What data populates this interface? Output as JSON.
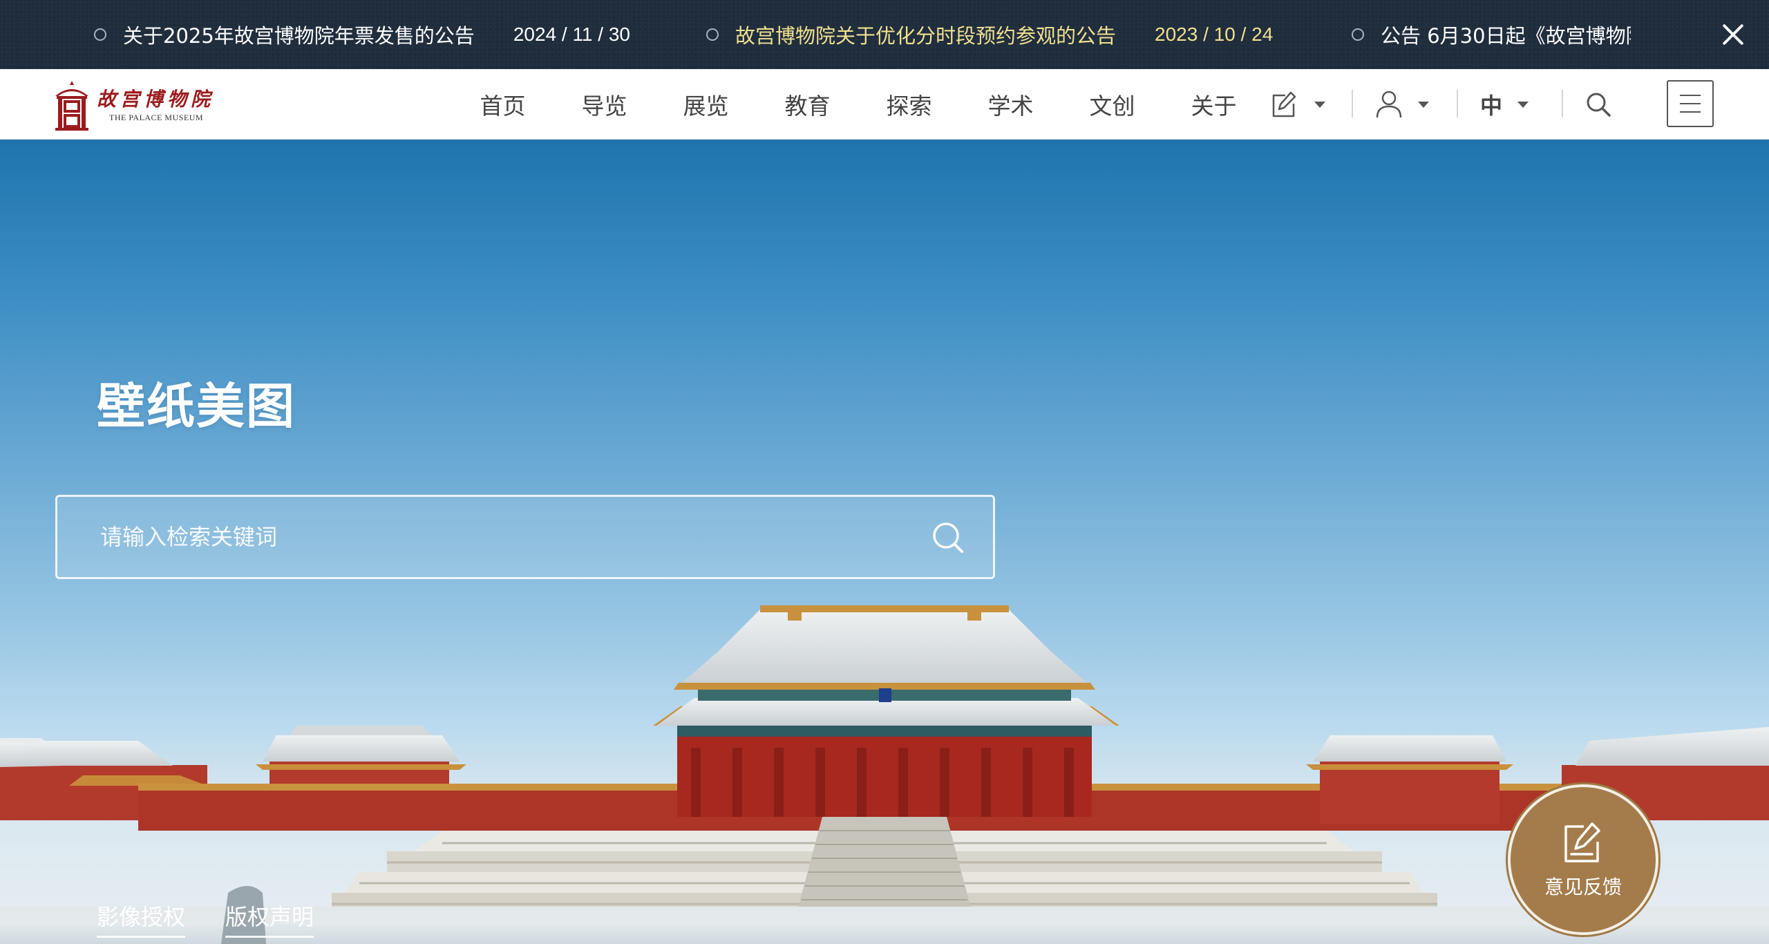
{
  "announcements": {
    "items": [
      {
        "title": "关于2025年故宫博物院年票发售的公告",
        "date": "2024 / 11 / 30",
        "active": false
      },
      {
        "title": "故宫博物院关于优化分时段预约参观的公告",
        "date": "2023 / 10 / 24",
        "active": true
      },
      {
        "title": "公告 6月30日起《故宫博物院",
        "date": "",
        "active": false
      }
    ],
    "close_icon": "close-icon"
  },
  "logo": {
    "name_cn": "故宫博物院",
    "name_en": "THE PALACE MUSEUM",
    "color": "#9b1b1e"
  },
  "nav": {
    "items": [
      "首页",
      "导览",
      "展览",
      "教育",
      "探索",
      "学术",
      "文创",
      "关于"
    ],
    "tools": {
      "edit_icon": "edit-icon",
      "user_icon": "user-icon",
      "language": "中",
      "search_icon": "search-icon",
      "menu_icon": "menu-icon"
    }
  },
  "hero": {
    "title": "壁纸美图",
    "search": {
      "placeholder": "请输入检索关键词"
    },
    "footer_links": [
      "影像授权",
      "版权声明"
    ],
    "feedback": {
      "label": "意见反馈",
      "icon": "edit-note-icon",
      "color": "#a47c4b"
    }
  },
  "colors": {
    "announcement_bg": "#1f2d3d",
    "announcement_active": "#f0e08f",
    "nav_text": "#444444"
  }
}
